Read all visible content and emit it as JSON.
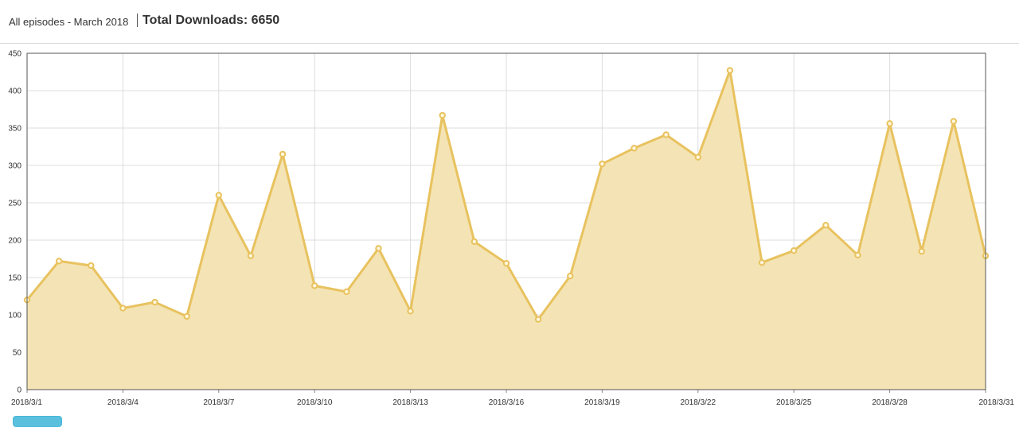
{
  "header": {
    "subtitle": "All episodes - March 2018",
    "total_label": "Total Downloads: 6650"
  },
  "colors": {
    "line": "#e8c25f",
    "fill": "#f3e3b1",
    "grid": "#dddddd",
    "plot_border": "#555555",
    "tab": "#5bc0de"
  },
  "chart_data": {
    "type": "area",
    "title": "",
    "xlabel": "",
    "ylabel": "",
    "ylim": [
      0,
      450
    ],
    "y_ticks": [
      "0",
      "50",
      "100",
      "150",
      "200",
      "250",
      "300",
      "350",
      "400",
      "450"
    ],
    "x": [
      "2018/3/1",
      "2018/3/2",
      "2018/3/3",
      "2018/3/4",
      "2018/3/5",
      "2018/3/6",
      "2018/3/7",
      "2018/3/8",
      "2018/3/9",
      "2018/3/10",
      "2018/3/11",
      "2018/3/12",
      "2018/3/13",
      "2018/3/14",
      "2018/3/15",
      "2018/3/16",
      "2018/3/17",
      "2018/3/18",
      "2018/3/19",
      "2018/3/20",
      "2018/3/21",
      "2018/3/22",
      "2018/3/23",
      "2018/3/24",
      "2018/3/25",
      "2018/3/26",
      "2018/3/27",
      "2018/3/28",
      "2018/3/29",
      "2018/3/30",
      "2018/3/31"
    ],
    "x_tick_labels": [
      "2018/3/1",
      "2018/3/4",
      "2018/3/7",
      "2018/3/10",
      "2018/3/13",
      "2018/3/16",
      "2018/3/19",
      "2018/3/22",
      "2018/3/25",
      "2018/3/28",
      "2018/3/31"
    ],
    "values": [
      120,
      172,
      166,
      109,
      117,
      98,
      260,
      179,
      315,
      139,
      131,
      189,
      105,
      367,
      198,
      169,
      94,
      152,
      302,
      323,
      341,
      311,
      427,
      170,
      186,
      220,
      180,
      356,
      185,
      359,
      179
    ],
    "grid": true,
    "legend": "none"
  }
}
